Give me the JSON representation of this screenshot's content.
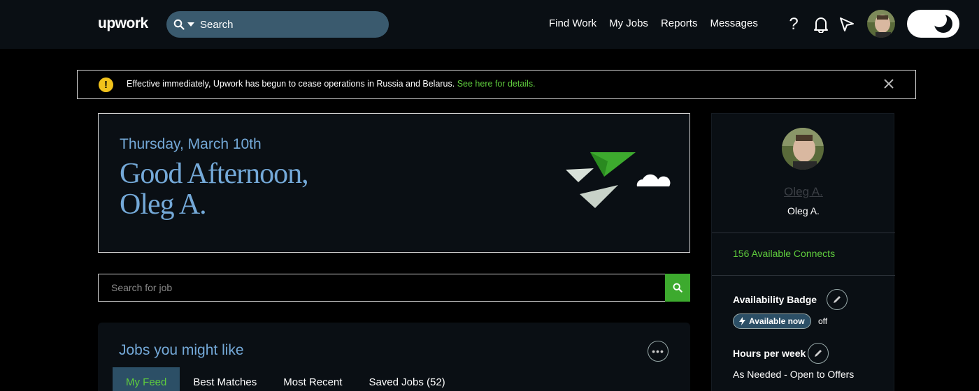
{
  "nav": {
    "logo": "upwork",
    "search_placeholder": "Search",
    "links": [
      "Find Work",
      "My Jobs",
      "Reports",
      "Messages"
    ],
    "icons": [
      "help-icon",
      "bell-icon",
      "send-icon",
      "avatar",
      "dark-mode-toggle"
    ]
  },
  "alert": {
    "message": "Effective immediately, Upwork has begun to cease operations in Russia and Belarus.",
    "link": "See here for details."
  },
  "greeting": {
    "date": "Thursday, March 10th",
    "line1": "Good Afternoon,",
    "line2": "Oleg A."
  },
  "job_search": {
    "placeholder": "Search for job"
  },
  "feed": {
    "title": "Jobs you might like",
    "tabs": [
      "My Feed",
      "Best Matches",
      "Most Recent",
      "Saved Jobs (52)"
    ],
    "active_tab": "My Feed"
  },
  "profile": {
    "name_link": "Oleg A.",
    "name": "Oleg A.",
    "connects": "156 Available Connects",
    "availability_heading": "Availability Badge",
    "availability_badge": "Available now",
    "availability_status": "off",
    "hours_heading": "Hours per week",
    "hours_value": "As Needed - Open to Offers"
  },
  "colors": {
    "accent_green": "#3daa2e",
    "link_green": "#5fcc3d",
    "heading_blue": "#74a9d8",
    "nav_bg": "#0a0f14",
    "warning": "#f1c21b"
  }
}
